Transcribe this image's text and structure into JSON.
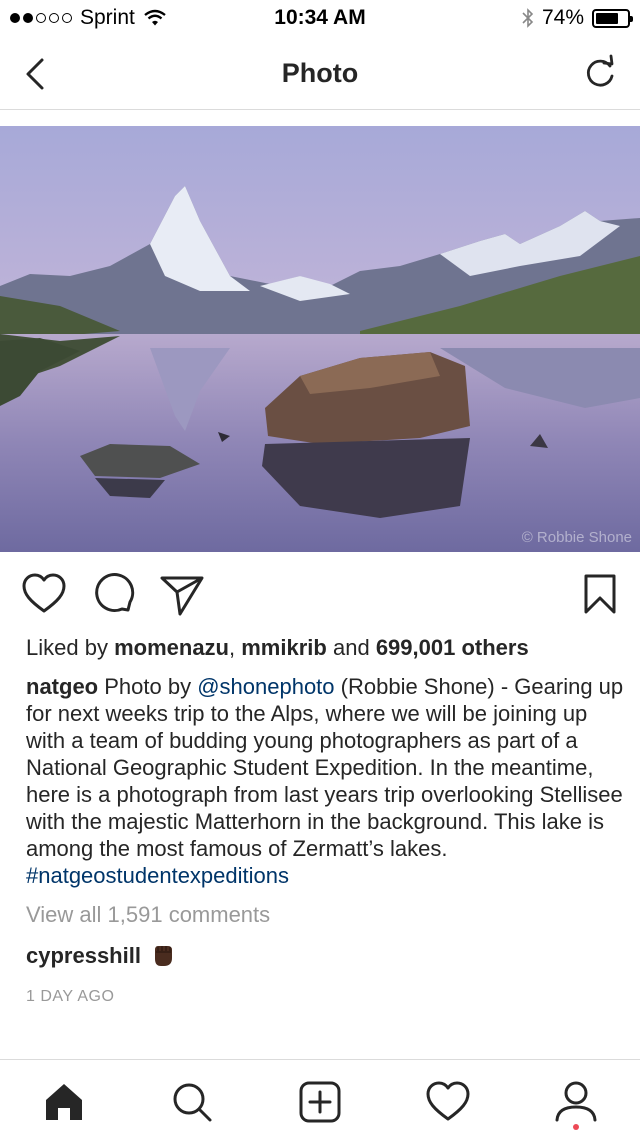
{
  "status_bar": {
    "carrier": "Sprint",
    "time": "10:34 AM",
    "battery_percent": "74%",
    "battery_level": 0.74,
    "signal_bars_filled": 2,
    "signal_bars_total": 5
  },
  "nav": {
    "title": "Photo",
    "back_icon": "chevron-left-icon",
    "refresh_icon": "refresh-icon"
  },
  "photo": {
    "credit": "© Robbie Shone",
    "description_icon": "landscape-photo"
  },
  "actions": {
    "like_icon": "heart-icon",
    "comment_icon": "comment-bubble-icon",
    "share_icon": "send-icon",
    "save_icon": "bookmark-icon"
  },
  "post": {
    "likes_prefix": "Liked by",
    "liker1": "momenazu",
    "liker_sep": ",",
    "liker2": "mmikrib",
    "likes_and": "and",
    "likes_count": "699,001 others",
    "author": "natgeo",
    "caption_pre": " Photo by ",
    "mention": "@shonephoto",
    "caption_body": " (Robbie Shone) - Gearing up for next weeks trip to the Alps, where we will be joining up with a team of budding young photographers as part of a National Geographic Student Expedition. In the meantime, here is a photograph from last years trip overlooking Stellisee with the majestic Matterhorn in the background. This lake is among the most famous of Zermatt’s lakes.",
    "hashtag": "#natgeostudentexpeditions",
    "view_all": "View all 1,591 comments",
    "comment_user": "cypresshill",
    "comment_emoji": "raised-fist-icon",
    "time_ago": "1 DAY AGO"
  },
  "tabbar": {
    "items": [
      "home-icon",
      "search-icon",
      "add-post-icon",
      "activity-heart-icon",
      "profile-icon"
    ],
    "accent": "#ed4956"
  }
}
